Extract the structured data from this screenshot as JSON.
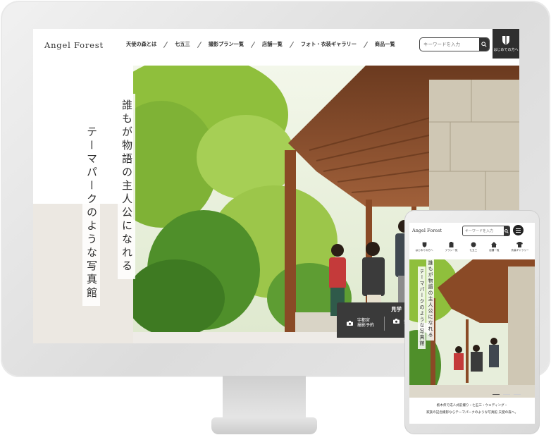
{
  "desktop": {
    "logo": "Angel Forest",
    "nav": [
      "天使の森とは",
      "七五三",
      "撮影プラン一覧",
      "店舗一覧",
      "フォト・衣装ギャラリー",
      "商品一覧"
    ],
    "search_placeholder": "キーワードを入力",
    "first_time_label": "はじめての方へ",
    "tagline_1": "誰もが物語の主人公になれる",
    "tagline_2": "テーマパークのような写真館",
    "visit": {
      "title": "見学",
      "item1": "宇都宮\n撮影予約",
      "item2": "撮"
    }
  },
  "tablet": {
    "logo": "Angel Forest",
    "search_placeholder": "キーワードを入力",
    "nav": [
      "はじめての方へ",
      "プラン一覧",
      "七五三",
      "店舗一覧",
      "衣装ギャラリー"
    ],
    "tagline_1": "誰もが物語の主人公になれる",
    "tagline_2": "テーマパークのような写真館",
    "caption_1": "栃木県で成人式前撮り・七五三・ウェディング・",
    "caption_2": "家族の記念撮影ならテーマパークのような写真館 天使の森へ。"
  },
  "colors": {
    "dark": "#2f2f2f",
    "beige": "#ece8e2",
    "bezel": "#e2e2e2"
  },
  "icons": [
    "search-icon",
    "shield-icon",
    "camera-icon",
    "calendar-icon",
    "hamburger-icon"
  ]
}
